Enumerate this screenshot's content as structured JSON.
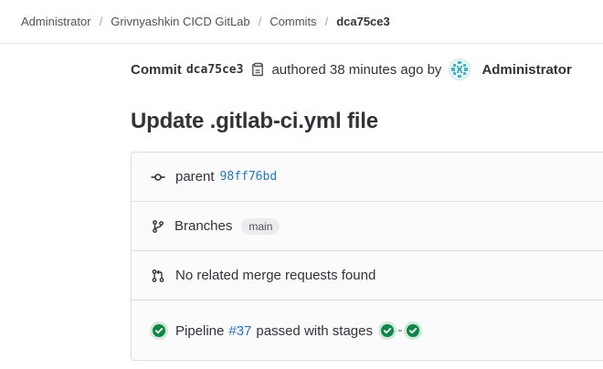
{
  "breadcrumb": {
    "items": [
      "Administrator",
      "Grivnyashkin CICD GitLab",
      "Commits",
      "dca75ce3"
    ],
    "separator": "/"
  },
  "commit": {
    "label": "Commit",
    "short_sha": "dca75ce3",
    "authored_text": "authored 38 minutes ago by",
    "author": "Administrator",
    "title": "Update .gitlab-ci.yml file"
  },
  "info": {
    "parent_label": "parent",
    "parent_sha": "98ff76bd",
    "branches_label": "Branches",
    "branch": "main",
    "merge_requests_text": "No related merge requests found",
    "pipeline_label": "Pipeline",
    "pipeline_id": "#37",
    "pipeline_status_text": "passed with stages"
  },
  "icons": {
    "copy": "copy-icon",
    "commit": "commit-icon",
    "branch": "branch-icon",
    "merge_request": "merge-request-icon",
    "status_success": "status-success-icon"
  },
  "colors": {
    "link": "#1f75cb",
    "success": "#108548",
    "text": "#333238",
    "muted": "#535158"
  }
}
